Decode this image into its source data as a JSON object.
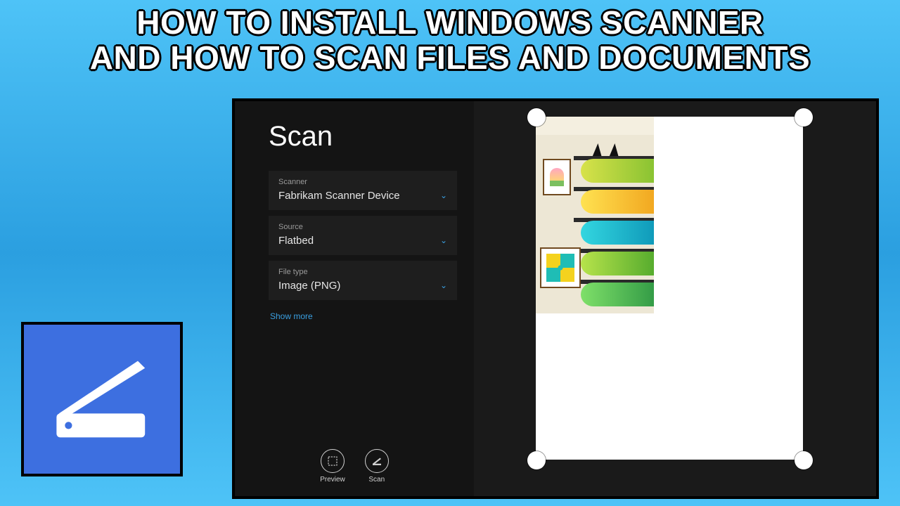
{
  "banner": {
    "line1": "HOW TO INSTALL WINDOWS SCANNER",
    "line2": "AND HOW TO SCAN FILES AND DOCUMENTS"
  },
  "app": {
    "title": "Scan",
    "tile_icon": "scanner-icon"
  },
  "settings": {
    "scanner": {
      "label": "Scanner",
      "value": "Fabrikam Scanner Device"
    },
    "source": {
      "label": "Source",
      "value": "Flatbed"
    },
    "filetype": {
      "label": "File type",
      "value": "Image (PNG)"
    },
    "show_more": "Show more"
  },
  "actions": {
    "preview": "Preview",
    "scan": "Scan"
  }
}
